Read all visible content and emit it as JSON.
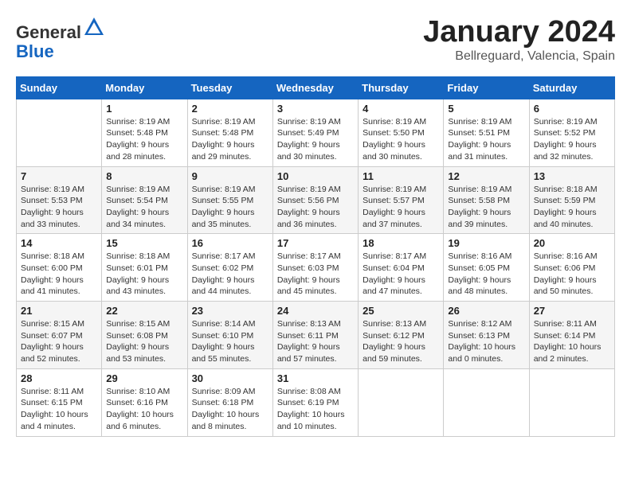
{
  "logo": {
    "general": "General",
    "blue": "Blue"
  },
  "title": {
    "month_year": "January 2024",
    "location": "Bellreguard, Valencia, Spain"
  },
  "days_of_week": [
    "Sunday",
    "Monday",
    "Tuesday",
    "Wednesday",
    "Thursday",
    "Friday",
    "Saturday"
  ],
  "weeks": [
    [
      {
        "day": "",
        "info": ""
      },
      {
        "day": "1",
        "info": "Sunrise: 8:19 AM\nSunset: 5:48 PM\nDaylight: 9 hours\nand 28 minutes."
      },
      {
        "day": "2",
        "info": "Sunrise: 8:19 AM\nSunset: 5:48 PM\nDaylight: 9 hours\nand 29 minutes."
      },
      {
        "day": "3",
        "info": "Sunrise: 8:19 AM\nSunset: 5:49 PM\nDaylight: 9 hours\nand 30 minutes."
      },
      {
        "day": "4",
        "info": "Sunrise: 8:19 AM\nSunset: 5:50 PM\nDaylight: 9 hours\nand 30 minutes."
      },
      {
        "day": "5",
        "info": "Sunrise: 8:19 AM\nSunset: 5:51 PM\nDaylight: 9 hours\nand 31 minutes."
      },
      {
        "day": "6",
        "info": "Sunrise: 8:19 AM\nSunset: 5:52 PM\nDaylight: 9 hours\nand 32 minutes."
      }
    ],
    [
      {
        "day": "7",
        "info": "Sunrise: 8:19 AM\nSunset: 5:53 PM\nDaylight: 9 hours\nand 33 minutes."
      },
      {
        "day": "8",
        "info": "Sunrise: 8:19 AM\nSunset: 5:54 PM\nDaylight: 9 hours\nand 34 minutes."
      },
      {
        "day": "9",
        "info": "Sunrise: 8:19 AM\nSunset: 5:55 PM\nDaylight: 9 hours\nand 35 minutes."
      },
      {
        "day": "10",
        "info": "Sunrise: 8:19 AM\nSunset: 5:56 PM\nDaylight: 9 hours\nand 36 minutes."
      },
      {
        "day": "11",
        "info": "Sunrise: 8:19 AM\nSunset: 5:57 PM\nDaylight: 9 hours\nand 37 minutes."
      },
      {
        "day": "12",
        "info": "Sunrise: 8:19 AM\nSunset: 5:58 PM\nDaylight: 9 hours\nand 39 minutes."
      },
      {
        "day": "13",
        "info": "Sunrise: 8:18 AM\nSunset: 5:59 PM\nDaylight: 9 hours\nand 40 minutes."
      }
    ],
    [
      {
        "day": "14",
        "info": "Sunrise: 8:18 AM\nSunset: 6:00 PM\nDaylight: 9 hours\nand 41 minutes."
      },
      {
        "day": "15",
        "info": "Sunrise: 8:18 AM\nSunset: 6:01 PM\nDaylight: 9 hours\nand 43 minutes."
      },
      {
        "day": "16",
        "info": "Sunrise: 8:17 AM\nSunset: 6:02 PM\nDaylight: 9 hours\nand 44 minutes."
      },
      {
        "day": "17",
        "info": "Sunrise: 8:17 AM\nSunset: 6:03 PM\nDaylight: 9 hours\nand 45 minutes."
      },
      {
        "day": "18",
        "info": "Sunrise: 8:17 AM\nSunset: 6:04 PM\nDaylight: 9 hours\nand 47 minutes."
      },
      {
        "day": "19",
        "info": "Sunrise: 8:16 AM\nSunset: 6:05 PM\nDaylight: 9 hours\nand 48 minutes."
      },
      {
        "day": "20",
        "info": "Sunrise: 8:16 AM\nSunset: 6:06 PM\nDaylight: 9 hours\nand 50 minutes."
      }
    ],
    [
      {
        "day": "21",
        "info": "Sunrise: 8:15 AM\nSunset: 6:07 PM\nDaylight: 9 hours\nand 52 minutes."
      },
      {
        "day": "22",
        "info": "Sunrise: 8:15 AM\nSunset: 6:08 PM\nDaylight: 9 hours\nand 53 minutes."
      },
      {
        "day": "23",
        "info": "Sunrise: 8:14 AM\nSunset: 6:10 PM\nDaylight: 9 hours\nand 55 minutes."
      },
      {
        "day": "24",
        "info": "Sunrise: 8:13 AM\nSunset: 6:11 PM\nDaylight: 9 hours\nand 57 minutes."
      },
      {
        "day": "25",
        "info": "Sunrise: 8:13 AM\nSunset: 6:12 PM\nDaylight: 9 hours\nand 59 minutes."
      },
      {
        "day": "26",
        "info": "Sunrise: 8:12 AM\nSunset: 6:13 PM\nDaylight: 10 hours\nand 0 minutes."
      },
      {
        "day": "27",
        "info": "Sunrise: 8:11 AM\nSunset: 6:14 PM\nDaylight: 10 hours\nand 2 minutes."
      }
    ],
    [
      {
        "day": "28",
        "info": "Sunrise: 8:11 AM\nSunset: 6:15 PM\nDaylight: 10 hours\nand 4 minutes."
      },
      {
        "day": "29",
        "info": "Sunrise: 8:10 AM\nSunset: 6:16 PM\nDaylight: 10 hours\nand 6 minutes."
      },
      {
        "day": "30",
        "info": "Sunrise: 8:09 AM\nSunset: 6:18 PM\nDaylight: 10 hours\nand 8 minutes."
      },
      {
        "day": "31",
        "info": "Sunrise: 8:08 AM\nSunset: 6:19 PM\nDaylight: 10 hours\nand 10 minutes."
      },
      {
        "day": "",
        "info": ""
      },
      {
        "day": "",
        "info": ""
      },
      {
        "day": "",
        "info": ""
      }
    ]
  ]
}
